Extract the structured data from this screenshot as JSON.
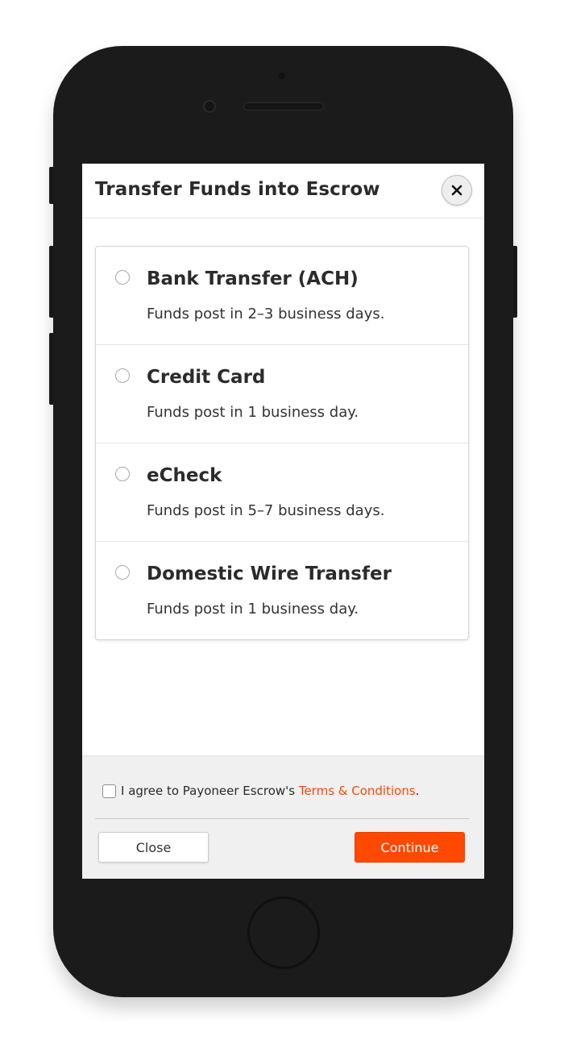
{
  "modal": {
    "title": "Transfer Funds into Escrow",
    "close_icon": "close-x-icon"
  },
  "payment_options": [
    {
      "title": "Bank Transfer (ACH)",
      "description": "Funds post in 2–3 business days.",
      "selected": false
    },
    {
      "title": "Credit Card",
      "description": "Funds post in 1 business day.",
      "selected": false
    },
    {
      "title": "eCheck",
      "description": "Funds post in 5–7 business days.",
      "selected": false
    },
    {
      "title": "Domestic Wire Transfer",
      "description": "Funds post in 1 business day.",
      "selected": false
    }
  ],
  "footer": {
    "agree_prefix": "I agree to Payoneer Escrow's ",
    "terms_link": "Terms & Conditions",
    "agree_suffix": ".",
    "agree_checked": false,
    "close_label": "Close",
    "continue_label": "Continue"
  },
  "colors": {
    "accent": "#ff4800",
    "device_body": "#1b1b1b",
    "footer_bg": "#f0f0f0"
  }
}
